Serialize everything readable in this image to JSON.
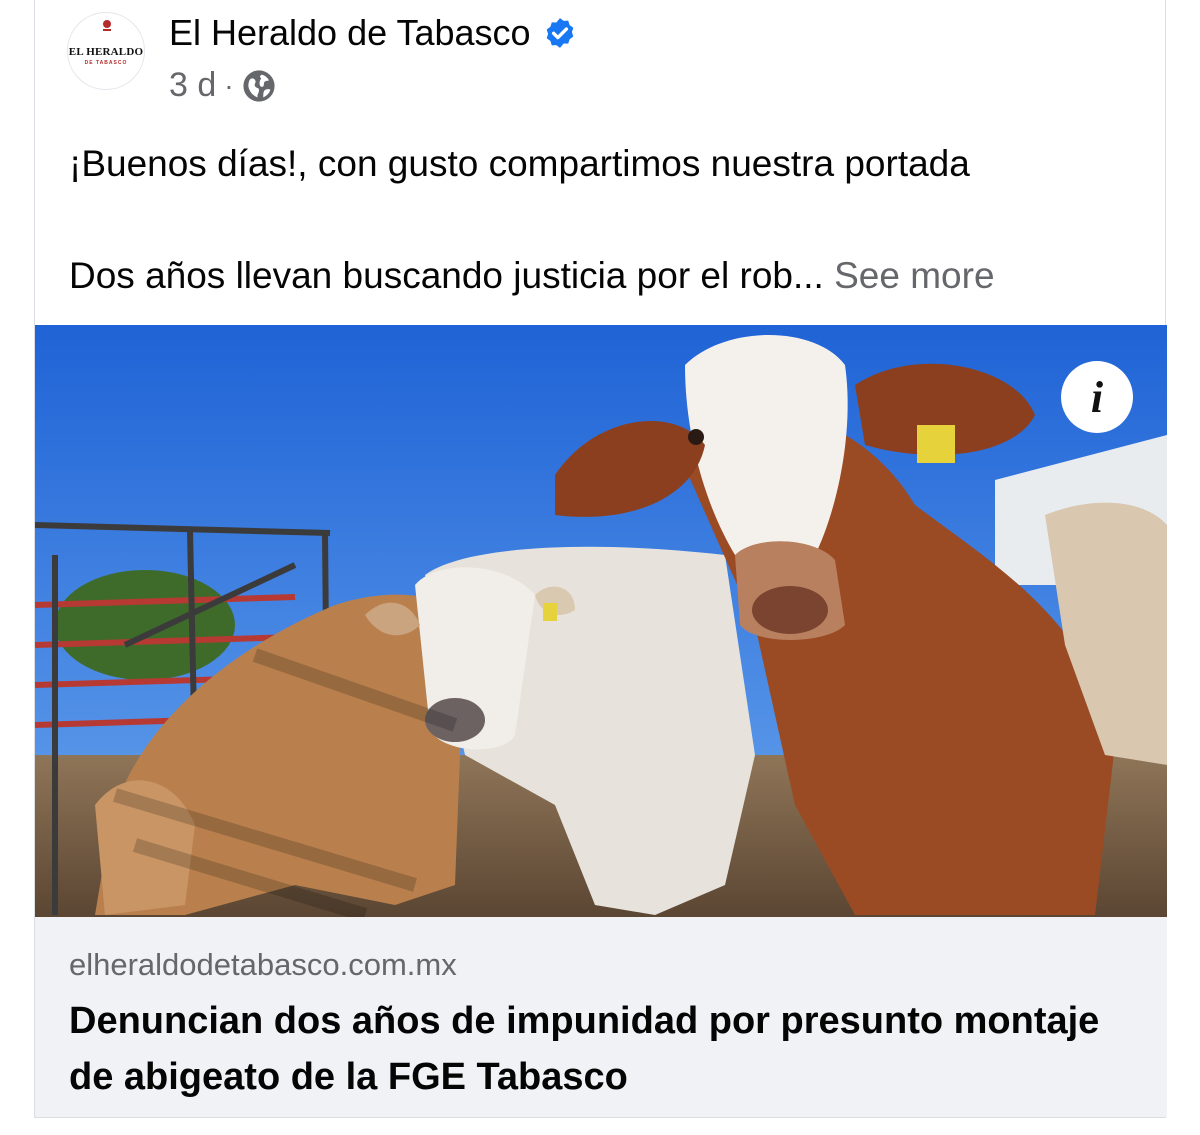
{
  "post": {
    "page_name": "El Heraldo de Tabasco",
    "verified_icon": "verified-badge-icon",
    "time": "3 d",
    "separator": "·",
    "audience_icon": "globe-icon",
    "text_line1": "¡Buenos días!, con gusto compartimos nuestra portada",
    "text_line2": "Dos años llevan buscando justicia por el rob...",
    "see_more": "See more"
  },
  "avatar": {
    "logo_text": "EL HERALDO",
    "logo_sub": "DE TABASCO"
  },
  "link_preview": {
    "info_label": "i",
    "domain": "elheraldodetabasco.com.mx",
    "headline": "Denuncian dos años de impunidad por presunto montaje de abigeato de la FGE Tabasco"
  },
  "colors": {
    "verified": "#1877f2",
    "secondary_text": "#65676b",
    "footer_bg": "#f0f2f5"
  }
}
